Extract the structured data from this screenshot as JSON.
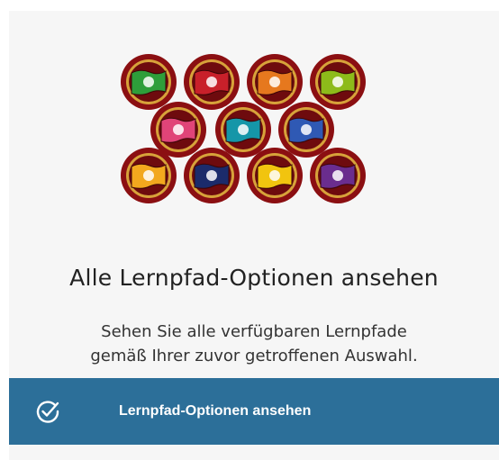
{
  "card": {
    "title": "Alle Lernpfad-Optionen ansehen",
    "description": "Sehen Sie alle verfügbaren Lernpfade gemäß Ihrer zuvor getroffenen Auswahl.",
    "action_label": "Lernpfad-Optionen ansehen",
    "action_icon": "check-circle-icon"
  },
  "badges": [
    {
      "icon": "microphone-icon",
      "color": "#2e9e3a"
    },
    {
      "icon": "banquet-icon",
      "color": "#c8202a"
    },
    {
      "icon": "telescope-icon",
      "color": "#e6781e"
    },
    {
      "icon": "audience-icon",
      "color": "#8dbb1a"
    },
    {
      "icon": "presenter-icon",
      "color": "#e04478"
    },
    {
      "icon": "lightbulb-icon",
      "color": "#1596a8"
    },
    {
      "icon": "team-icon",
      "color": "#2f59b4"
    },
    {
      "icon": "theater-masks-icon",
      "color": "#f2a81e"
    },
    {
      "icon": "d-logo-icon",
      "color": "#1b2b6b"
    },
    {
      "icon": "bridge-icon",
      "color": "#f1c40f"
    },
    {
      "icon": "handshake-icon",
      "color": "#6a2d8e"
    }
  ],
  "colors": {
    "accent": "#2c6f99",
    "card_background": "#f6f6f6",
    "badge_ring": "#8b0f12"
  }
}
